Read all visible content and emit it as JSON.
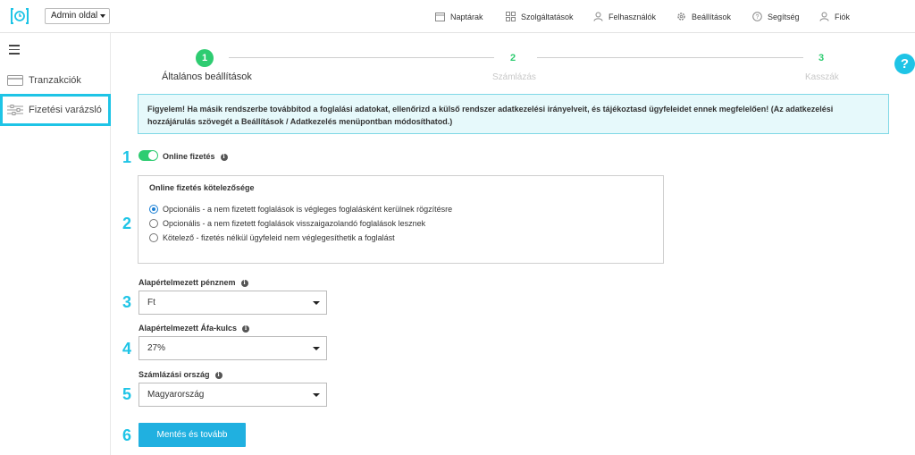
{
  "header": {
    "admin_select": "Admin oldal",
    "nav": [
      {
        "label": "Naptárak",
        "icon": "calendar-icon"
      },
      {
        "label": "Szolgáltatások",
        "icon": "grid-icon"
      },
      {
        "label": "Felhasználók",
        "icon": "users-icon"
      },
      {
        "label": "Beállítások",
        "icon": "gear-icon"
      },
      {
        "label": "Segítség",
        "icon": "help-circle-icon"
      },
      {
        "label": "Fiók",
        "icon": "user-icon"
      }
    ]
  },
  "sidebar": {
    "items": [
      {
        "label": "Tranzakciók",
        "icon": "card-icon"
      },
      {
        "label": "Fizetési varázsló",
        "icon": "sliders-icon",
        "active": true
      }
    ]
  },
  "stepper": {
    "steps": [
      {
        "number": "1",
        "label": "Általános beállítások",
        "state": "active"
      },
      {
        "number": "2",
        "label": "Számlázás",
        "state": "upcoming"
      },
      {
        "number": "3",
        "label": "Kasszák",
        "state": "upcoming"
      }
    ]
  },
  "alert": {
    "text": "Figyelem! Ha másik rendszerbe továbbítod a foglalási adatokat, ellenőrizd a külső rendszer adatkezelési irányelveit, és tájékoztasd ügyfeleidet ennek megfelelően! (Az adatkezelési hozzájárulás szövegét a Beállítások / Adatkezelés menüpontban módosíthatod.)"
  },
  "markers": [
    "1",
    "2",
    "3",
    "4",
    "5",
    "6"
  ],
  "online_payment": {
    "label": "Online fizetés",
    "enabled": true
  },
  "obligation": {
    "legend": "Online fizetés kötelezősége",
    "options": [
      {
        "label": "Opcionális - a nem fizetett foglalások is végleges foglalásként kerülnek rögzítésre",
        "selected": true
      },
      {
        "label": "Opcionális - a nem fizetett foglalások visszaigazolandó foglalások lesznek",
        "selected": false
      },
      {
        "label": "Kötelező - fizetés nélkül ügyfeleid nem véglegesíthetik a foglalást",
        "selected": false
      }
    ]
  },
  "currency": {
    "label": "Alapértelmezett pénznem",
    "value": "Ft"
  },
  "vat": {
    "label": "Alapértelmezett Áfa-kulcs",
    "value": "27%"
  },
  "country": {
    "label": "Számlázási ország",
    "value": "Magyarország"
  },
  "submit_label": "Mentés és tovább",
  "help_glyph": "?",
  "colors": {
    "accent": "#1ec4e6",
    "success": "#2ecc71",
    "button": "#20b0e0"
  }
}
